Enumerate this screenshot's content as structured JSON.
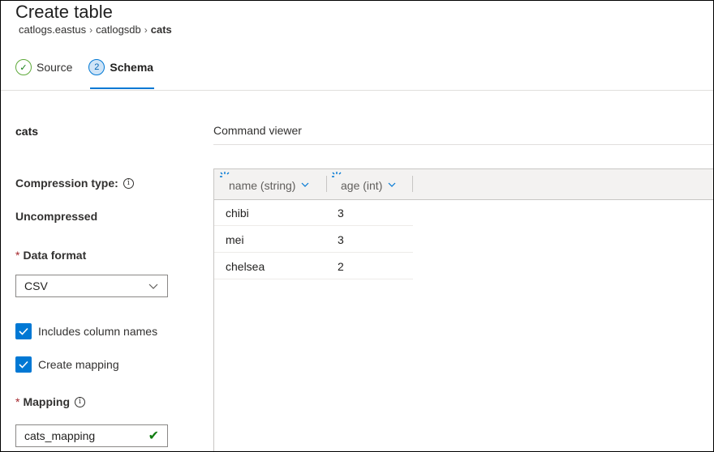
{
  "header": {
    "title": "Create table",
    "breadcrumb": [
      "catlogs.eastus",
      "catlogsdb",
      "cats"
    ]
  },
  "steps": [
    {
      "number": "✓",
      "label": "Source",
      "state": "completed"
    },
    {
      "number": "2",
      "label": "Schema",
      "state": "active"
    }
  ],
  "table_name": "cats",
  "command_viewer_label": "Command viewer",
  "compression": {
    "label": "Compression type:",
    "value": "Uncompressed"
  },
  "data_format": {
    "required_mark": "*",
    "label": "Data format",
    "selected": "CSV"
  },
  "checkboxes": {
    "includes_column_names": {
      "label": "Includes column names",
      "checked": true
    },
    "create_mapping": {
      "label": "Create mapping",
      "checked": true
    }
  },
  "mapping": {
    "required_mark": "*",
    "label": "Mapping",
    "value": "cats_mapping"
  },
  "grid": {
    "columns": [
      "name (string)",
      "age (int)"
    ],
    "rows": [
      [
        "chibi",
        "3"
      ],
      [
        "mei",
        "3"
      ],
      [
        "chelsea",
        "2"
      ]
    ]
  },
  "colors": {
    "accent": "#0078d4",
    "success": "#107c10",
    "required": "#a4262c"
  }
}
